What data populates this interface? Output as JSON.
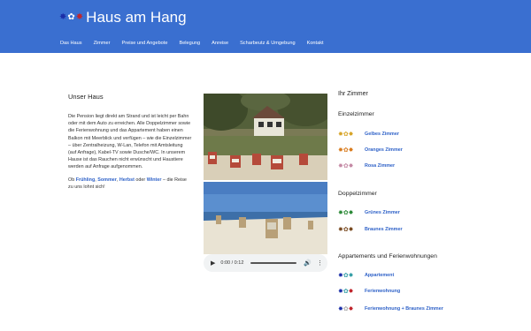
{
  "header": {
    "title": "Haus am Hang",
    "logo_dots": [
      {
        "glyph": "✸",
        "color": "#1b2ea8"
      },
      {
        "glyph": "✿",
        "color": "#ffffff"
      },
      {
        "glyph": "✸",
        "color": "#c0262d"
      }
    ],
    "bg_color": "#3a6fd0"
  },
  "nav": [
    "Das Haus",
    "Zimmer",
    "Preise und Angebote",
    "Belegung",
    "Anreise",
    "Scharbeutz & Umgebung",
    "Kontakt"
  ],
  "intro": {
    "heading": "Unser Haus",
    "paragraph": "Die Pension liegt direkt am Strand und ist leicht per Bahn oder mit dem Auto zu erreichen. Alle Doppelzimmer sowie die Ferienwohnung und das Appartement haben einen Balkon mit Meerblick und verfügen – wie die Einzelzimmer – über Zentralheizung, W-Lan, Telefon mit Amtsleitung (auf Anfrage), Kabel-TV sowie Dusche/WC. In unserem Hause ist das Rauchen nicht erwünscht und Haustiere werden auf Anfrage aufgenommen.",
    "seasons_prefix": "Ob",
    "season_1": "Frühling",
    "season_2": "Sommer",
    "season_3": "Herbst",
    "season_or": "oder",
    "season_4": "Winter",
    "seasons_suffix": "– die Reise zu uns lohnt sich!"
  },
  "audio": {
    "time": "0:00 / 0:12"
  },
  "rooms": {
    "heading": "Ihr Zimmer",
    "single_heading": "Einzelzimmer",
    "double_heading": "Doppelzimmer",
    "apartments_heading": "Appartements und Ferienwohnungen",
    "single": [
      {
        "label": "Gelbes Zimmer",
        "colors": [
          "#d7a52a",
          "#d7a52a",
          "#d7a52a"
        ]
      },
      {
        "label": "Oranges Zimmer",
        "colors": [
          "#d97c1f",
          "#d97c1f",
          "#d97c1f"
        ]
      },
      {
        "label": "Rosa Zimmer",
        "colors": [
          "#c58aa5",
          "#c58aa5",
          "#c58aa5"
        ]
      }
    ],
    "double": [
      {
        "label": "Grünes Zimmer",
        "colors": [
          "#2e8b3a",
          "#2e8b3a",
          "#2e8b3a"
        ]
      },
      {
        "label": "Braunes Zimmer",
        "colors": [
          "#7a4b22",
          "#7a4b22",
          "#7a4b22"
        ]
      }
    ],
    "apartments": [
      {
        "label": "Appartement",
        "colors": [
          "#1b2ea8",
          "#38a0a8",
          "#38a0a8"
        ]
      },
      {
        "label": "Ferienwohnung",
        "colors": [
          "#1b2ea8",
          "#38a0a8",
          "#c0262d"
        ]
      },
      {
        "label": "Ferienwohnung + Braunes Zimmer",
        "colors": [
          "#1b2ea8",
          "#aaaaaa",
          "#c0262d"
        ]
      }
    ]
  }
}
